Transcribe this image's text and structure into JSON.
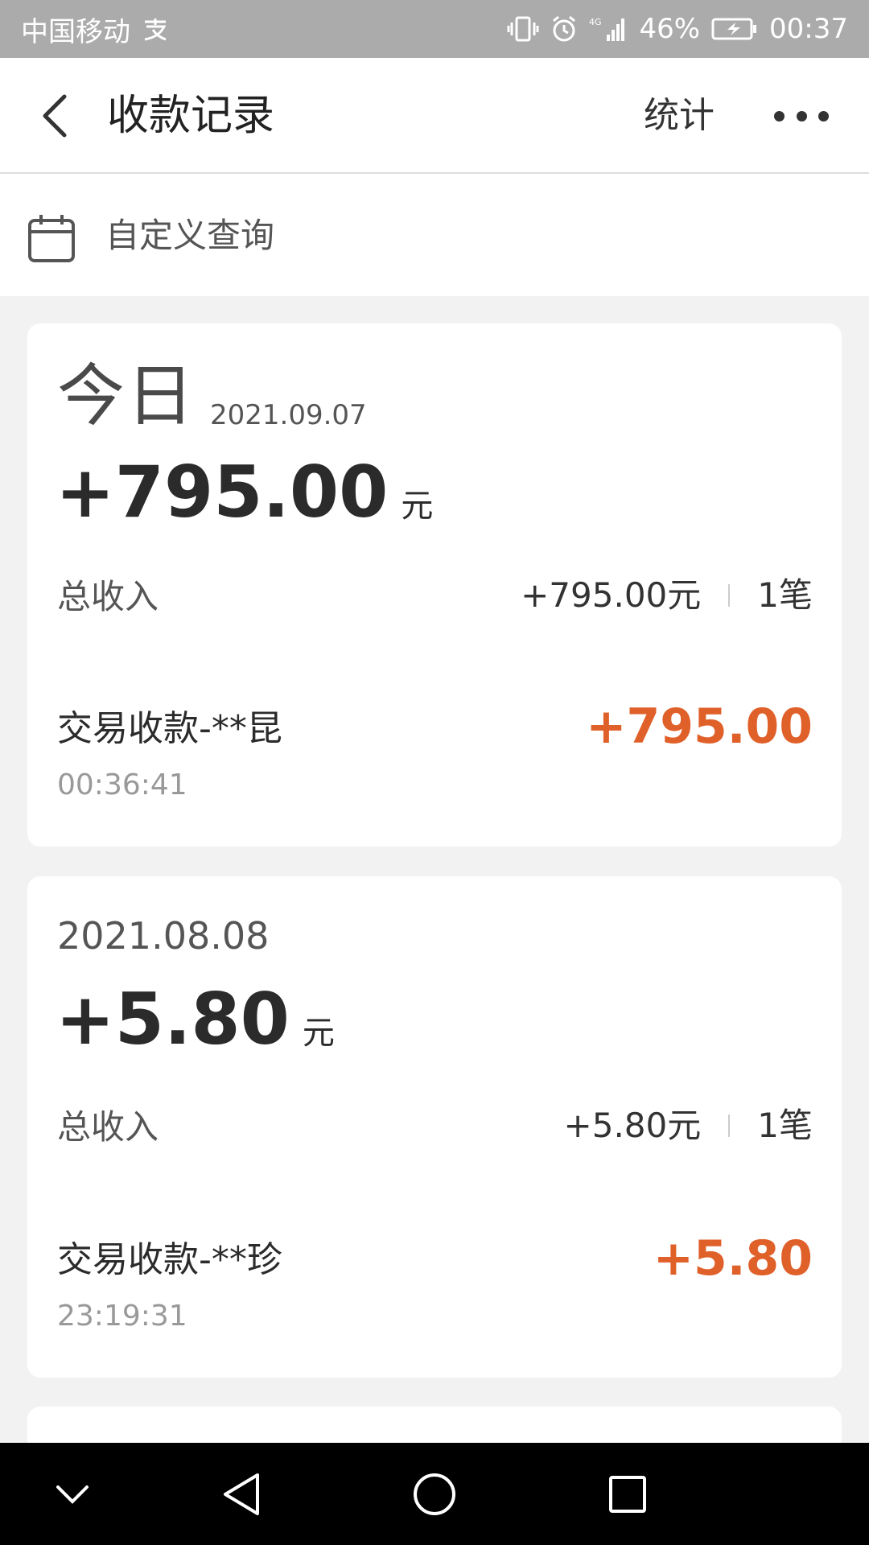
{
  "status_bar": {
    "carrier": "中国移动",
    "battery": "46%",
    "time": "00:37",
    "network": "4G"
  },
  "header": {
    "title": "收款记录",
    "stats_label": "统计"
  },
  "filter": {
    "label": "自定义查询"
  },
  "colors": {
    "accent": "#e0602a",
    "status_bar": "#ababab",
    "background": "#f2f2f2"
  },
  "cards": [
    {
      "day_label": "今日",
      "date": "2021.09.07",
      "total": "+795.00",
      "unit": "元",
      "summary_label": "总收入",
      "summary_amount": "+795.00元",
      "summary_count": "1笔",
      "transactions": [
        {
          "name": "交易收款-**昆",
          "time": "00:36:41",
          "amount": "+795.00"
        }
      ]
    },
    {
      "date": "2021.08.08",
      "total": "+5.80",
      "unit": "元",
      "summary_label": "总收入",
      "summary_amount": "+5.80元",
      "summary_count": "1笔",
      "transactions": [
        {
          "name": "交易收款-**珍",
          "time": "23:19:31",
          "amount": "+5.80"
        }
      ]
    }
  ],
  "icons": {
    "back": "back-arrow-icon",
    "more": "more-dots-icon",
    "calendar": "calendar-icon",
    "nav_down": "chevron-down-icon",
    "nav_back": "triangle-back-icon",
    "nav_home": "circle-home-icon",
    "nav_recent": "square-recent-icon"
  }
}
